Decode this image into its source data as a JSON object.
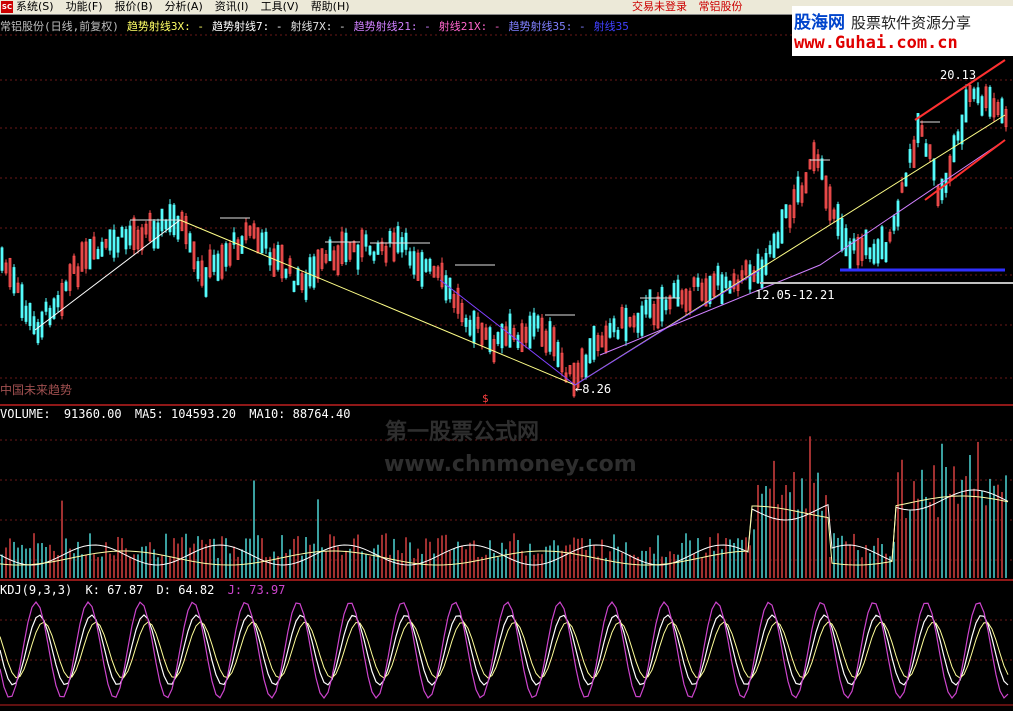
{
  "menubar": {
    "logo": "SC",
    "items": [
      "系统(S)",
      "功能(F)",
      "报价(B)",
      "分析(A)",
      "资讯(I)",
      "工具(V)",
      "帮助(H)"
    ],
    "status": [
      "交易未登录",
      "常铝股份"
    ]
  },
  "watermark_top": {
    "line1_a": "股海网",
    "line1_b": "股票软件资源分享",
    "line2": "www.Guhai.com.cn"
  },
  "chart_header": {
    "stock": "常铝股份(日线,前复权)",
    "items": [
      {
        "label": "趋势射线3X",
        "value": ": -",
        "color": "#ffff66"
      },
      {
        "label": "趋势射线7",
        "value": ": -",
        "color": "#ffffff"
      },
      {
        "label": "射线7X",
        "value": ": -",
        "color": "#e0e0e0"
      },
      {
        "label": "趋势射线21",
        "value": ": -",
        "color": "#d080ff"
      },
      {
        "label": "射线21X",
        "value": ": -",
        "color": "#ff66cc"
      },
      {
        "label": "趋势射线35",
        "value": ": -",
        "color": "#8080ff"
      },
      {
        "label": "射线35",
        "value": "",
        "color": "#4040ff"
      }
    ]
  },
  "price_panel": {
    "high_label": "20.13",
    "low_label": "←8.26",
    "range_label": "12.05-12.21",
    "bottom_left_note": "中国未来趋势",
    "dollar_mark": "$"
  },
  "volume_panel": {
    "name": "VOLUME",
    "value": "91360.00",
    "ma5_label": "MA5",
    "ma5": "104593.20",
    "ma10_label": "MA10",
    "ma10": "88764.40"
  },
  "kdj_panel": {
    "name": "KDJ(9,3,3)",
    "k_label": "K",
    "k": "67.87",
    "d_label": "D",
    "d": "64.82",
    "j_label": "J",
    "j": "73.97"
  },
  "background_watermark": {
    "line1": "第一股票公式网",
    "line2": "www.chnmoney.com"
  },
  "colors": {
    "up": "#ff5050",
    "down": "#54fcfc",
    "grid": "#802020",
    "kdj_j": "#cc44cc"
  }
}
